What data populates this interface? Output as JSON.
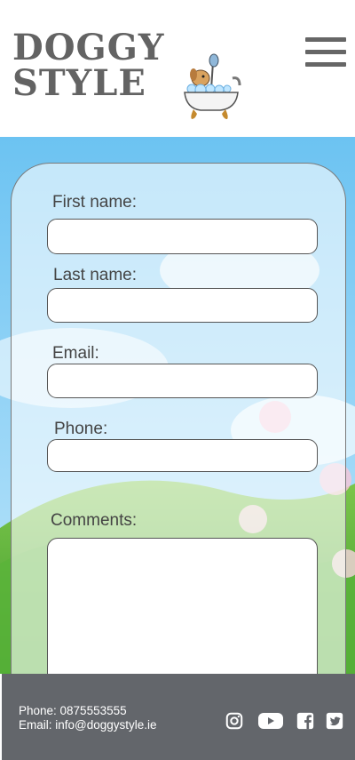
{
  "brand": {
    "line1": "DOGGY",
    "line2": "STYLE"
  },
  "form": {
    "first_name_label": "First name:",
    "last_name_label": "Last name:",
    "email_label": "Email:",
    "phone_label": "Phone:",
    "comments_label": "Comments:",
    "first_name_value": "",
    "last_name_value": "",
    "email_value": "",
    "phone_value": "",
    "comments_value": ""
  },
  "footer": {
    "phone": "Phone: 0875553555",
    "email": "Email: info@doggystyle.ie",
    "icons": [
      "instagram-icon",
      "youtube-icon",
      "facebook-icon",
      "twitter-icon"
    ]
  },
  "colors": {
    "footer_bg": "#63666b",
    "sky": "#8fd0f5",
    "grass": "#4cab3a"
  }
}
